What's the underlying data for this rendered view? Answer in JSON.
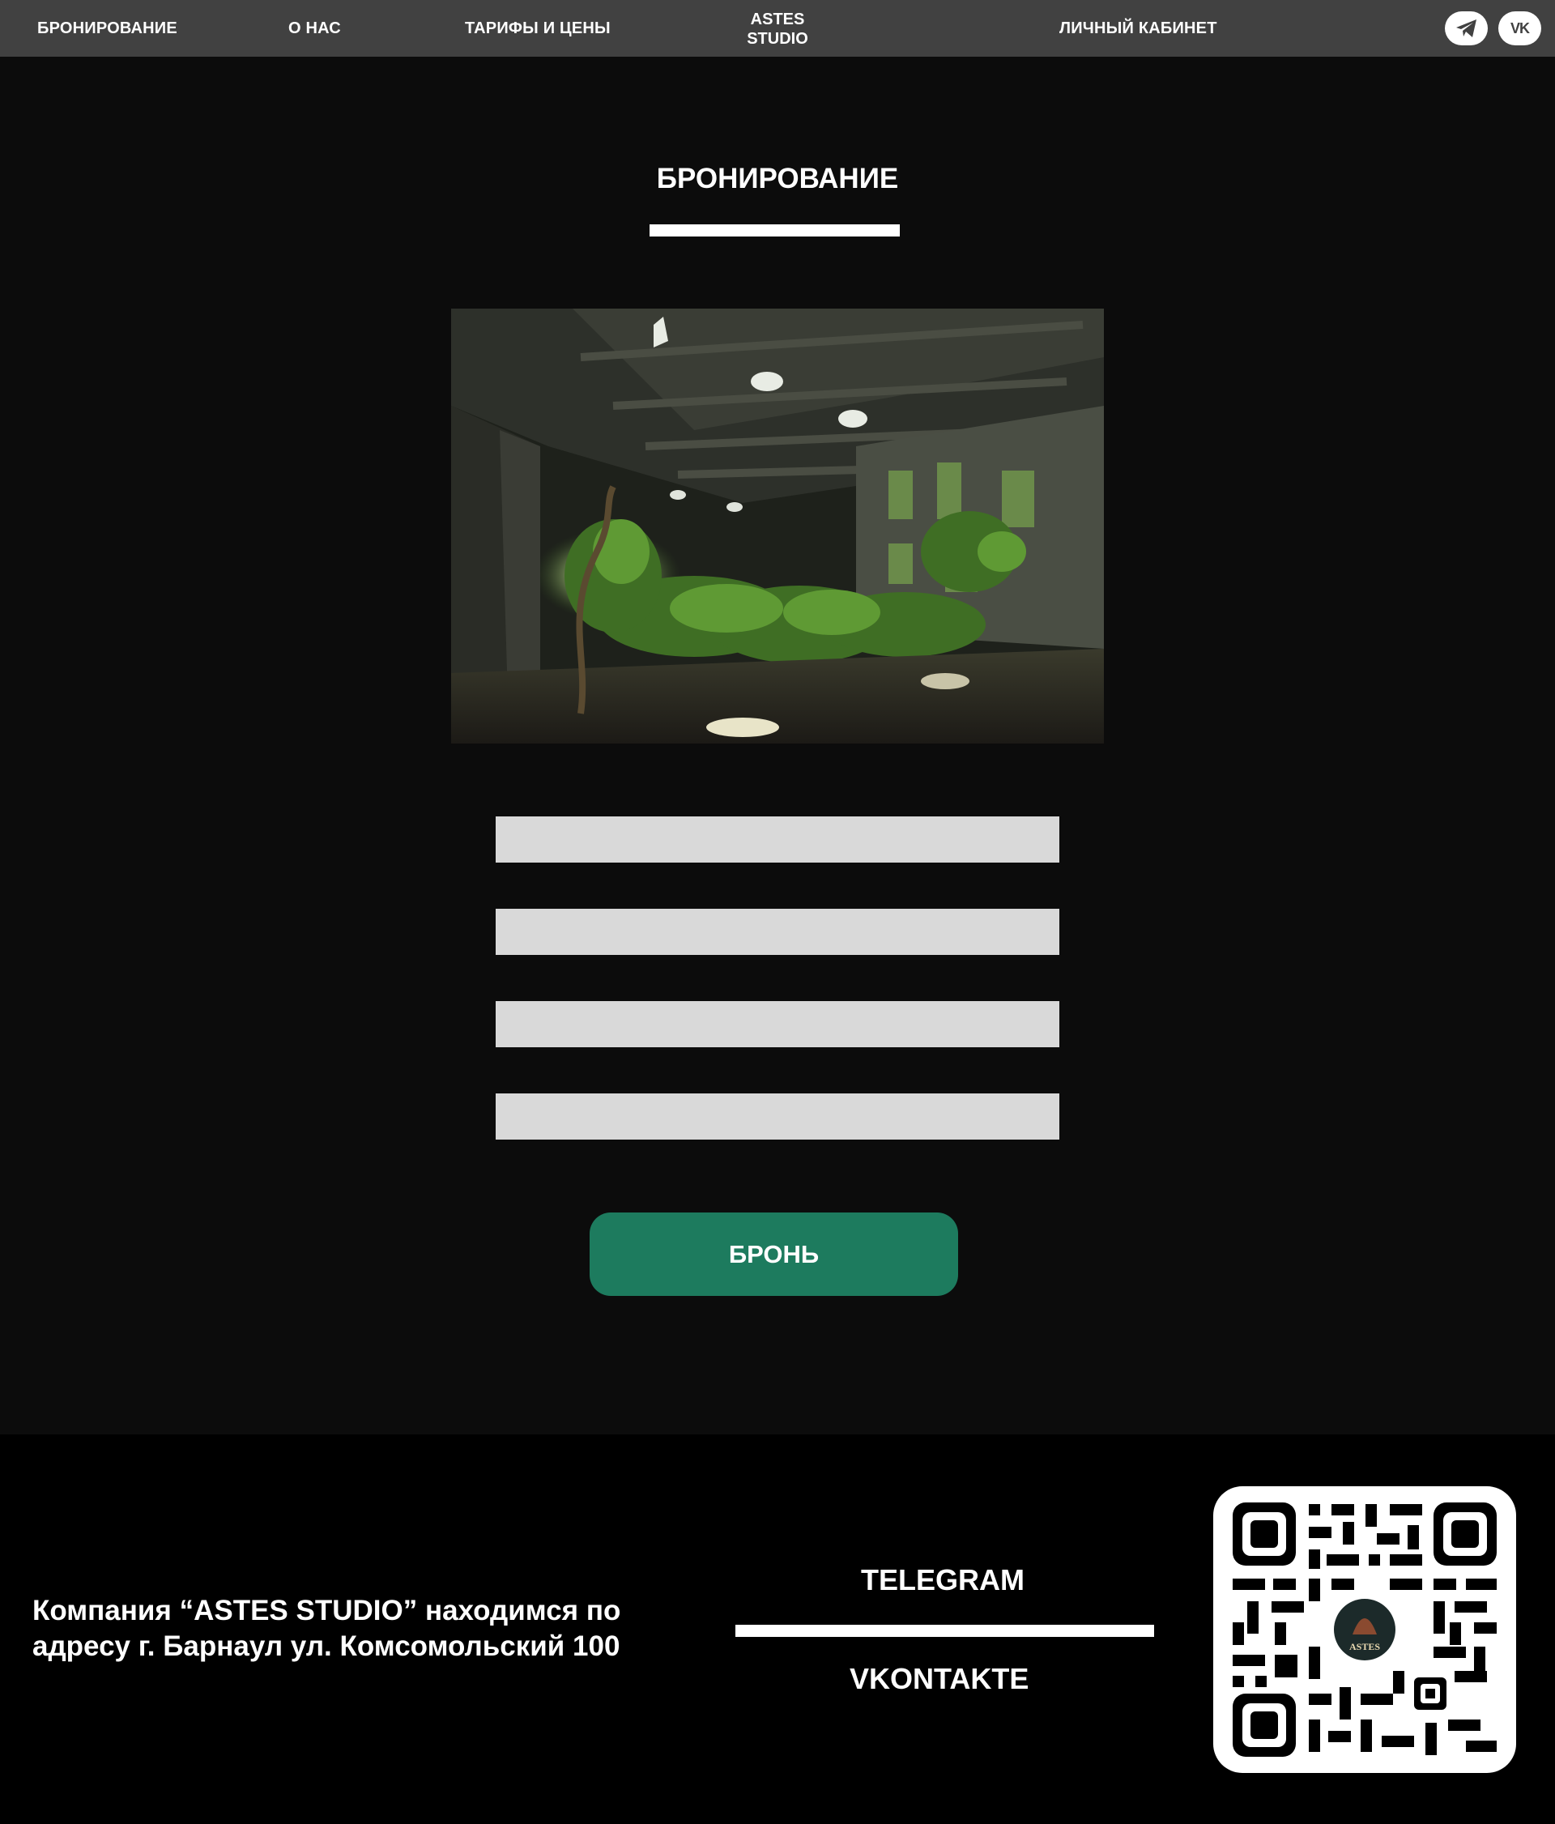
{
  "nav": {
    "booking": "БРОНИРОВАНИЕ",
    "about": "О НАС",
    "prices": "ТАРИФЫ И ЦЕНЫ",
    "brand_line1": "ASTES",
    "brand_line2": "STUDIO",
    "account": "ЛИЧНЫЙ КАБИНЕТ",
    "vk_icon_text": "VK",
    "icons": [
      "telegram-icon",
      "vk-icon"
    ]
  },
  "main": {
    "title": "БРОНИРОВАНИЕ",
    "hero_image": "abandoned-overgrown-building-photo",
    "form": {
      "fields": [
        "",
        "",
        "",
        ""
      ]
    },
    "submit_label": "БРОНЬ"
  },
  "footer": {
    "address_line1": "Компания “ASTES STUDIO” находимся по",
    "address_line2": "адресу г. Барнаул ул. Комсомольский 100",
    "telegram": "TELEGRAM",
    "vkontakte": "VKONTAKTE",
    "qr_logo_text": "ASTES"
  },
  "colors": {
    "nav_bg": "#414141",
    "page_bg": "#0c0c0c",
    "footer_bg": "#000000",
    "input_bg": "#d9d9d9",
    "button": "#1d7b5e",
    "text": "#ffffff"
  }
}
